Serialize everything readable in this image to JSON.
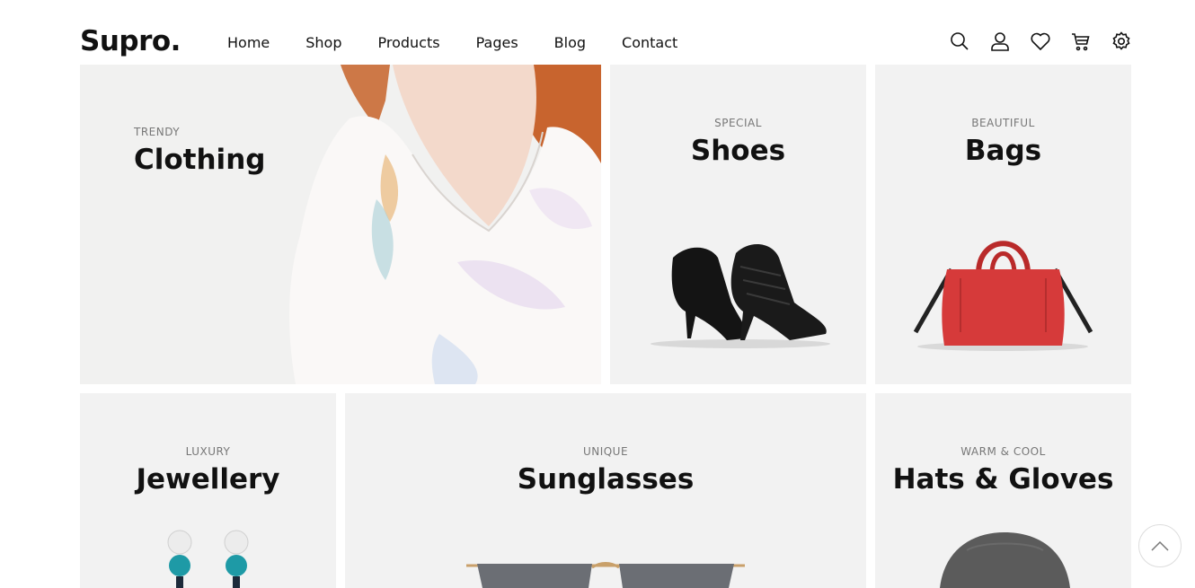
{
  "brand": {
    "logo": "Supro."
  },
  "nav": {
    "items": [
      "Home",
      "Shop",
      "Products",
      "Pages",
      "Blog",
      "Contact"
    ]
  },
  "header_icons": [
    "search-icon",
    "user-icon",
    "heart-icon",
    "cart-icon",
    "gear-icon"
  ],
  "categories": [
    {
      "subtitle": "TRENDY",
      "title": "Clothing"
    },
    {
      "subtitle": "SPECIAL",
      "title": "Shoes"
    },
    {
      "subtitle": "BEAUTIFUL",
      "title": "Bags"
    },
    {
      "subtitle": "LUXURY",
      "title": "Jewellery"
    },
    {
      "subtitle": "UNIQUE",
      "title": "Sunglasses"
    },
    {
      "subtitle": "WARM & COOL",
      "title": "Hats & Gloves"
    }
  ],
  "colors": {
    "tile_bg": "#f2f2f2",
    "text": "#111111",
    "bag_red": "#d63a3a"
  },
  "back_to_top_icon": "chevron-up-icon"
}
